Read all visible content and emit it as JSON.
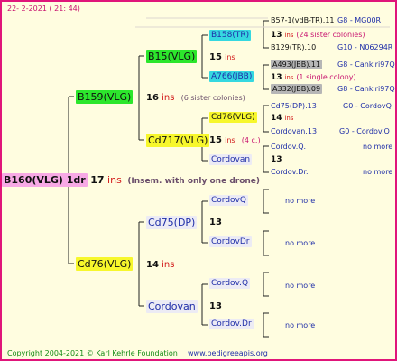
{
  "header": {
    "date": "22-  2-2021 ( 21: 44)"
  },
  "footer": {
    "copyright": "Copyright 2004-2021 © Karl Kehrle Foundation",
    "url": "www.pedigreeapis.org"
  },
  "colors": {
    "pink": "#f7a9e5",
    "green": "#2ce62c",
    "yellow": "#f7f72c",
    "cyan": "#35d8e0",
    "light": "#ecebf4",
    "grey": "#b6b6b6"
  },
  "root": {
    "name": "B160(VLG) 1dr",
    "num": "17",
    "ins": "ins",
    "note": "(Insem. with only one drone)"
  },
  "gen1": {
    "top": {
      "name": "B159(VLG)",
      "num": "16",
      "ins": "ins",
      "note": "(6 sister colonies)"
    },
    "bottom": {
      "name": "Cd76(VLG)",
      "num": "14",
      "ins": "ins"
    }
  },
  "gen2": {
    "a": {
      "name": "B15(VLG)",
      "num": "15",
      "ins": "ins"
    },
    "b": {
      "name": "Cd717(VLG)",
      "num": "15",
      "ins": "ins",
      "note": "(4 c.)"
    },
    "c": {
      "name": "Cd75(DP)",
      "num": "13"
    },
    "d": {
      "name": "Cordovan",
      "num": "13"
    }
  },
  "gen3": {
    "a": {
      "name": "B158(TR)"
    },
    "b": {
      "name": "A766(JBB)"
    },
    "c": {
      "name": "Cd76(VLG)",
      "num": "14",
      "ins": "ins"
    },
    "d": {
      "name": "Cordovan",
      "num": "13"
    },
    "e": {
      "name": "CordovQ"
    },
    "f": {
      "name": "CordovDr"
    },
    "g": {
      "name": "Cordov.Q"
    },
    "h": {
      "name": "Cordov.Dr"
    }
  },
  "gen4": {
    "r1": {
      "name": "B57-1(vdB-TR).11",
      "right": "G8 - MG00R"
    },
    "r2": {
      "num": "13",
      "ins": "ins",
      "note": "(24 sister colonies)"
    },
    "r3": {
      "name": "B129(TR).10",
      "right": "G10 - N06294R"
    },
    "r4": {
      "name": "A493(JBB).11",
      "right": "G8 - Cankiri97Q"
    },
    "r5": {
      "num": "13",
      "ins": "ins",
      "note": "(1 single colony)"
    },
    "r6": {
      "name": "A332(JBB).09",
      "right": "G8 - Cankiri97Q"
    },
    "r7": {
      "name": "Cd75(DP).13",
      "right": "G0 - CordovQ"
    },
    "r8": {
      "num": "14",
      "ins": "ins"
    },
    "r9": {
      "name": "Cordovan.13",
      "right": "G0 - Cordov.Q"
    },
    "r10": {
      "name": "Cordov.Q.",
      "right": "no more"
    },
    "r11": {
      "num": "13"
    },
    "r12": {
      "name": "Cordov.Dr.",
      "right": "no more"
    },
    "m1": "no more",
    "m2": "no more",
    "m3": "no more",
    "m4": "no more"
  }
}
